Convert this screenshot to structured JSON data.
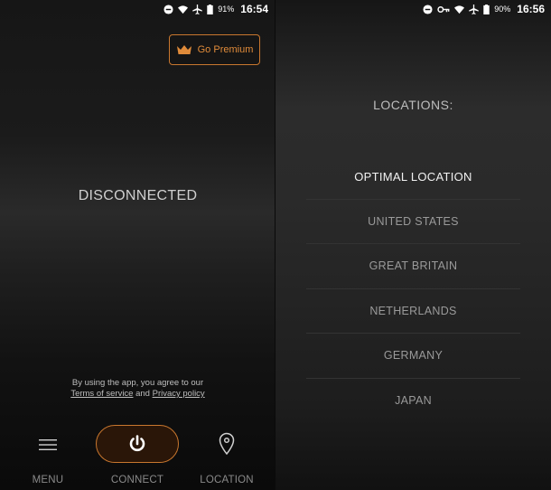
{
  "left": {
    "status": {
      "battery_pct": "91%",
      "time": "16:54"
    },
    "premium_label": "Go Premium",
    "connection_state": "DISCONNECTED",
    "terms": {
      "prefix": "By using the app, you agree to our",
      "tos": "Terms of service",
      "and": "and",
      "privacy": "Privacy policy"
    },
    "nav": {
      "menu": "MENU",
      "connect": "CONNECT",
      "location": "LOCATION"
    }
  },
  "right": {
    "status": {
      "battery_pct": "90%",
      "time": "16:56"
    },
    "title": "LOCATIONS:",
    "locations": [
      "OPTIMAL LOCATION",
      "UNITED STATES",
      "GREAT BRITAIN",
      "NETHERLANDS",
      "GERMANY",
      "JAPAN"
    ],
    "selected_index": 0
  },
  "colors": {
    "accent": "#c9772e",
    "accent_text": "#e08b3a"
  },
  "icons": [
    "dnd-icon",
    "wifi-icon",
    "airplane-icon",
    "battery-icon",
    "key-icon",
    "crown-icon",
    "menu-icon",
    "power-icon",
    "location-pin-icon"
  ]
}
